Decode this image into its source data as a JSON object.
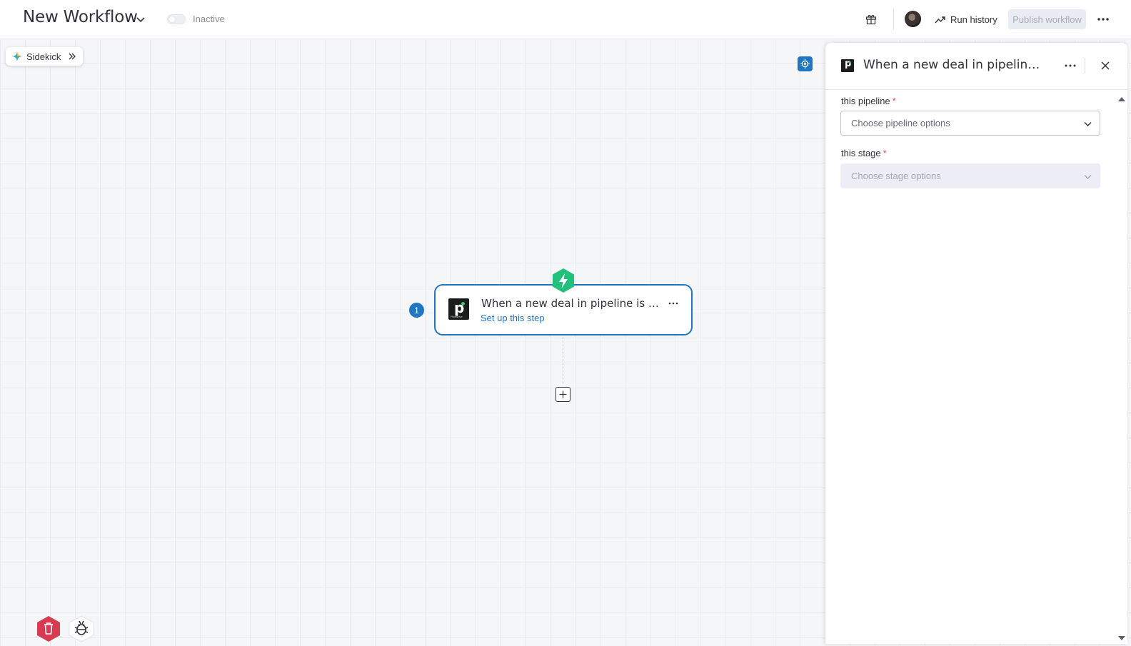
{
  "header": {
    "workflow_title": "New Workflow",
    "status_label": "Inactive",
    "run_history_label": "Run history",
    "publish_label": "Publish workflow"
  },
  "canvas": {
    "sidekick_label": "Sidekick",
    "step": {
      "number": "1",
      "title": "When a new deal in pipeline is updated",
      "link_label": "Set up this step",
      "app_logo_caption": "Pipedrive"
    }
  },
  "panel": {
    "title": "When a new deal in pipeline is updated",
    "fields": [
      {
        "label": "this pipeline",
        "required_mark": "*",
        "placeholder": "Choose pipeline options",
        "state": "enabled"
      },
      {
        "label": "this stage",
        "required_mark": "*",
        "placeholder": "Choose stage options",
        "state": "disabled"
      }
    ]
  },
  "colors": {
    "accent_blue": "#1f76c2",
    "trigger_green": "#22c07a",
    "danger_red": "#d83a52",
    "required_red": "#e2445c"
  },
  "icons": [
    "chevron-down-icon",
    "toggle-switch",
    "gift-icon",
    "avatar",
    "trend-line-icon",
    "more-horizontal-icon",
    "sparkle-icon",
    "double-chevron-right-icon",
    "locate-icon",
    "lightning-bolt-icon",
    "plus-icon",
    "trash-icon",
    "bug-icon",
    "close-icon",
    "scroll-arrow"
  ]
}
